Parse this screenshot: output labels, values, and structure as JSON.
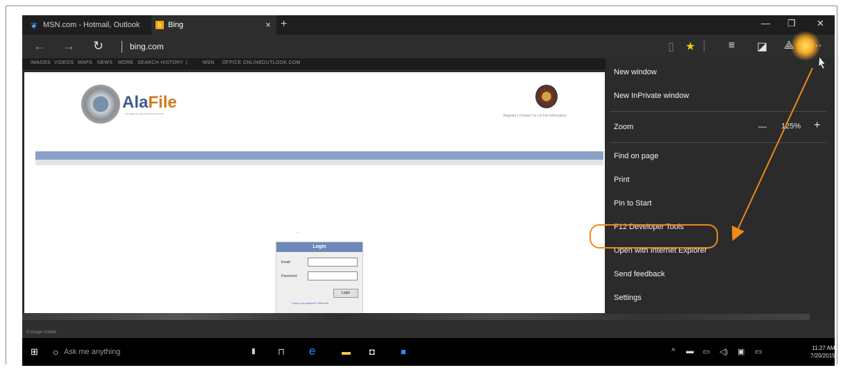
{
  "tabs": [
    {
      "label": "MSN.com - Hotmail, Outlook",
      "icon": "msn-butterfly-icon"
    },
    {
      "label": "Bing",
      "icon": "bing-icon",
      "close": "×"
    }
  ],
  "new_tab": "+",
  "window_controls": {
    "minimize": "—",
    "restore": "❐",
    "close": "✕"
  },
  "address": {
    "url": "bing.com"
  },
  "bing_nav": [
    "IMAGES",
    "VIDEOS",
    "MAPS",
    "NEWS",
    "MORE",
    "SEARCH HISTORY",
    "|",
    "MSN",
    "OFFICE ONLINE",
    "OUTLOOK.COM"
  ],
  "site": {
    "logo_text_a": "Ala",
    "logo_text_b": "File",
    "logo_sub": "brought to you by alacourt.com",
    "top_links": "Register  |  Contact Us  |  E-File Information",
    "dash": "-"
  },
  "login": {
    "header": "Login",
    "email_label": "Email:",
    "password_label": "Password:",
    "button": "Login",
    "forgot": "Forgot your password? Click here!"
  },
  "status": {
    "text": "© Image Credits"
  },
  "taskbar": {
    "search_placeholder": "Ask me anything",
    "time": "11:27 AM",
    "date": "7/20/2015"
  },
  "menu": {
    "new_window": "New window",
    "new_inprivate": "New InPrivate window",
    "zoom_label": "Zoom",
    "zoom_minus": "—",
    "zoom_value": "125%",
    "zoom_plus": "+",
    "find": "Find on page",
    "print": "Print",
    "pin": "Pin to Start",
    "f12": "F12 Developer Tools",
    "open_ie": "Open with Internet Explorer",
    "feedback": "Send feedback",
    "settings": "Settings"
  },
  "colors": {
    "menu_bg": "#2b2b2b",
    "annotation": "#f08a18",
    "taskbar": "#000000",
    "edge_blue": "#1e90ff"
  }
}
